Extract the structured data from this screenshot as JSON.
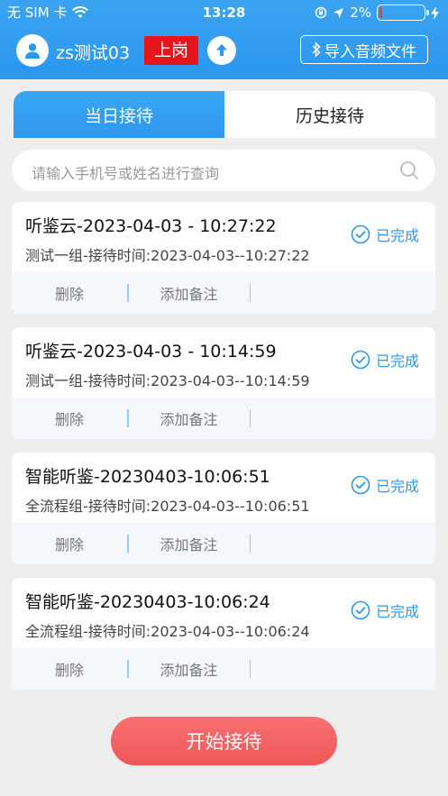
{
  "status_bar": {
    "carrier": "无 SIM 卡",
    "time": "13:28",
    "battery": "2%",
    "battery_level": 0.02
  },
  "nav": {
    "user_name": "zs测试03",
    "duty_badge": "上岗",
    "import_label": "导入音频文件"
  },
  "tabs": [
    {
      "label": "当日接待",
      "active": true
    },
    {
      "label": "历史接待",
      "active": false
    }
  ],
  "search": {
    "placeholder": "请输入手机号或姓名进行查询"
  },
  "records": [
    {
      "title": "听鉴云-2023-04-03 - 10:27:22",
      "subtitle": "测试一组-接待时间:2023-04-03--10:27:22",
      "status": "已完成",
      "delete_label": "删除",
      "note_label": "添加备注"
    },
    {
      "title": "听鉴云-2023-04-03 - 10:14:59",
      "subtitle": "测试一组-接待时间:2023-04-03--10:14:59",
      "status": "已完成",
      "delete_label": "删除",
      "note_label": "添加备注"
    },
    {
      "title": "智能听鉴-20230403-10:06:51",
      "subtitle": "全流程组-接待时间:2023-04-03--10:06:51",
      "status": "已完成",
      "delete_label": "删除",
      "note_label": "添加备注"
    },
    {
      "title": "智能听鉴-20230403-10:06:24",
      "subtitle": "全流程组-接待时间:2023-04-03--10:06:24",
      "status": "已完成",
      "delete_label": "删除",
      "note_label": "添加备注"
    }
  ],
  "start_button": "开始接待",
  "colors": {
    "primary": "#2b97ee",
    "badge_red": "#e8161c",
    "start_button": "#f05657",
    "background": "#eeeeee"
  }
}
